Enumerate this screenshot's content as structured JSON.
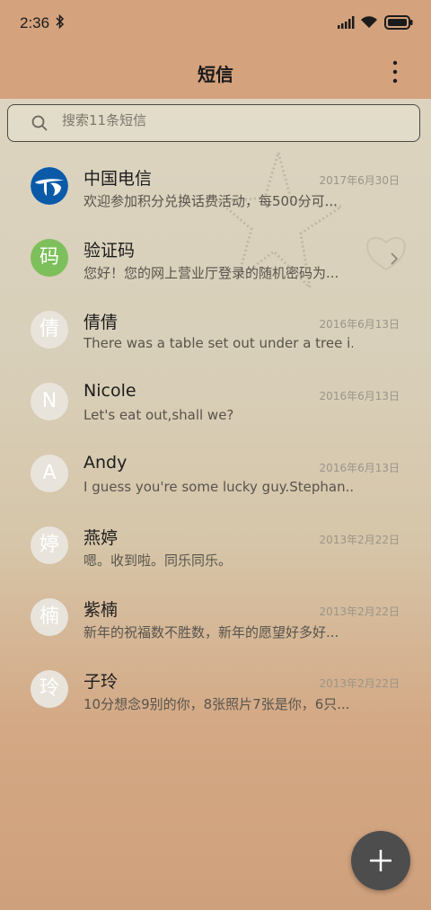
{
  "status": {
    "time": "2:36"
  },
  "app": {
    "title": "短信"
  },
  "search": {
    "placeholder": "搜索11条短信"
  },
  "conversations": [
    {
      "avatar": "",
      "name": "中国电信",
      "date": "2017年6月30日",
      "preview": "欢迎参加积分兑换话费活动，每500分可..."
    },
    {
      "avatar": "码",
      "name": "验证码",
      "date": "",
      "preview": "您好！您的网上营业厅登录的随机密码为..."
    },
    {
      "avatar": "倩",
      "name": "倩倩",
      "date": "2016年6月13日",
      "preview": "There was a table set out under a tree i..."
    },
    {
      "avatar": "N",
      "name": "Nicole",
      "date": "2016年6月13日",
      "preview": "Let's eat out,shall we?"
    },
    {
      "avatar": "A",
      "name": "Andy",
      "date": "2016年6月13日",
      "preview": "I guess you're some lucky guy.Stephan..."
    },
    {
      "avatar": "婷",
      "name": "燕婷",
      "date": "2013年2月22日",
      "preview": "嗯。收到啦。同乐同乐。"
    },
    {
      "avatar": "楠",
      "name": "紫楠",
      "date": "2013年2月22日",
      "preview": "新年的祝福数不胜数，新年的愿望好多好..."
    },
    {
      "avatar": "玲",
      "name": "子玲",
      "date": "2013年2月22日",
      "preview": "10分想念9别的你，8张照片7张是你，6只..."
    }
  ],
  "colors": {
    "header": "#d4a27d",
    "fab": "#4d4d4d",
    "verification_avatar": "#7dbf5a",
    "telecom_blue": "#0a5aa8"
  },
  "icons": [
    "bluetooth-icon",
    "signal-icon",
    "wifi-icon",
    "battery-icon",
    "more-icon",
    "search-icon",
    "chevron-right-icon",
    "plus-icon",
    "china-telecom-logo"
  ]
}
